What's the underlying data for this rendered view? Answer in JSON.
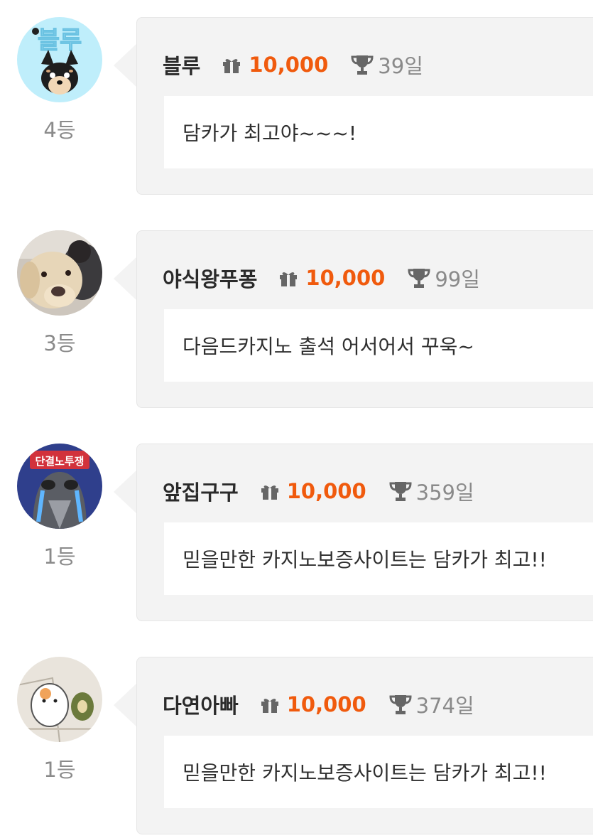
{
  "colors": {
    "accent": "#f05a0d",
    "muted": "#8a8a8a",
    "bubble_bg": "#f3f3f3"
  },
  "icons": {
    "points": "gift-icon",
    "attendance": "trophy-icon"
  },
  "entries": [
    {
      "avatar": "avatar-blue-chihuahua",
      "avatar_text": "블루",
      "rank": "4등",
      "username": "블루",
      "points": "10,000",
      "days": "39일",
      "message": "담카가 최고야~~~!"
    },
    {
      "avatar": "avatar-dog-photo",
      "rank": "3등",
      "username": "야식왕푸퐁",
      "points": "10,000",
      "days": "99일",
      "message": "다음드카지노 출석 어서어서 꾸욱~"
    },
    {
      "avatar": "avatar-crying-cartoon",
      "avatar_text": "단결노투쟁",
      "rank": "1등",
      "username": "앞집구구",
      "points": "10,000",
      "days": "359일",
      "message": "믿을만한 카지노보증사이트는 담카가 최고!!"
    },
    {
      "avatar": "avatar-hamster-cartoon",
      "rank": "1등",
      "username": "다연아빠",
      "points": "10,000",
      "days": "374일",
      "message": "믿을만한 카지노보증사이트는 담카가 최고!!"
    }
  ]
}
